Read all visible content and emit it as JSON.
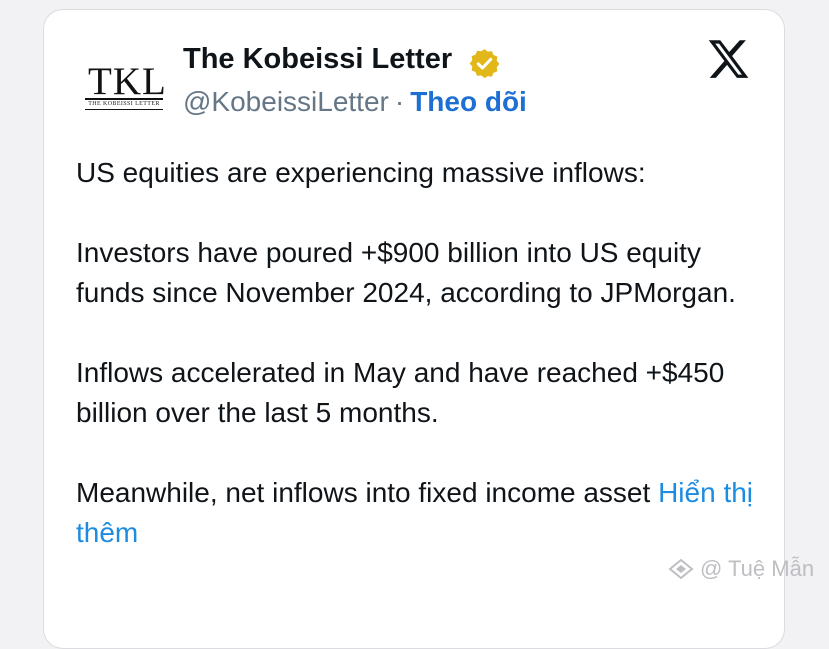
{
  "post": {
    "avatar": {
      "logo_text": "TKL",
      "logo_sub": "THE KOBEISSI LETTER",
      "icon": "avatar-logo"
    },
    "author_name": "The Kobeissi Letter",
    "verified_icon": "gold-verified-badge-icon",
    "handle": "@KobeissiLetter",
    "separator": "·",
    "follow_label": "Theo dõi",
    "platform_icon": "x-logo-icon",
    "paragraphs": [
      "US equities are experiencing massive inflows:",
      "Investors have poured +$900 billion into US equity funds since November 2024, according to JPMorgan.",
      "Inflows accelerated in May and have reached +$450 billion over the last 5 months."
    ],
    "last_paragraph_text": "Meanwhile, net inflows into fixed income asset",
    "show_more_label": "Hiển thị thêm"
  },
  "watermark": {
    "text": "@ Tuệ Mẫn",
    "icon": "diamond-logo-icon"
  },
  "colors": {
    "background": "#f2f2f4",
    "card": "#ffffff",
    "text": "#0f1419",
    "handle": "#657786",
    "follow": "#1d6fd1",
    "show_more": "#1d8ce0",
    "badge_gold": "#e2b719"
  }
}
